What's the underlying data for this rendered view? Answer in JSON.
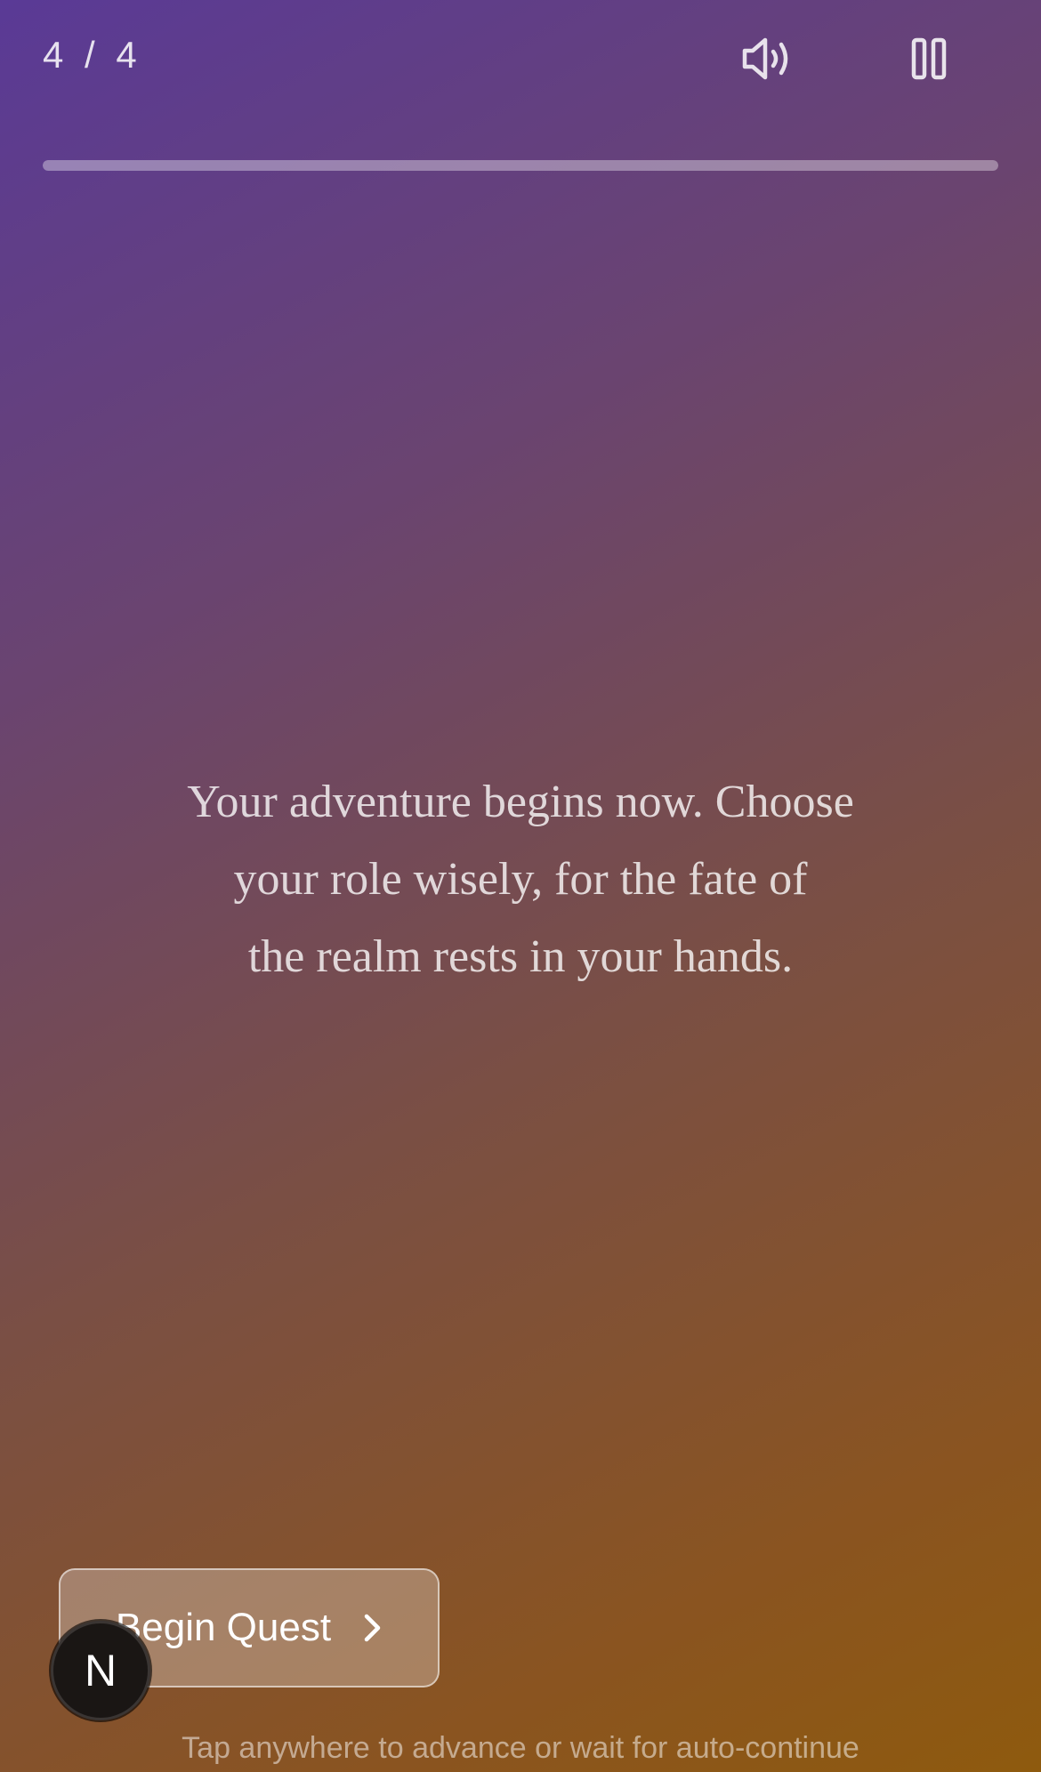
{
  "header": {
    "current_slide": "4",
    "separator": "/",
    "total_slides": "4"
  },
  "progress": {
    "fraction": 1.0
  },
  "icons": {
    "sound": "speaker-sound-icon",
    "pause": "pause-icon",
    "next": "chevron-right-icon"
  },
  "story": {
    "lines": [
      "Your adventure begins now. Choose",
      "your role wisely, for the fate of",
      "the realm rests in your hands."
    ]
  },
  "cta": {
    "label": "Begin Quest"
  },
  "avatar": {
    "letter": "N"
  },
  "hint": "Tap anywhere to advance or wait for auto-continue"
}
